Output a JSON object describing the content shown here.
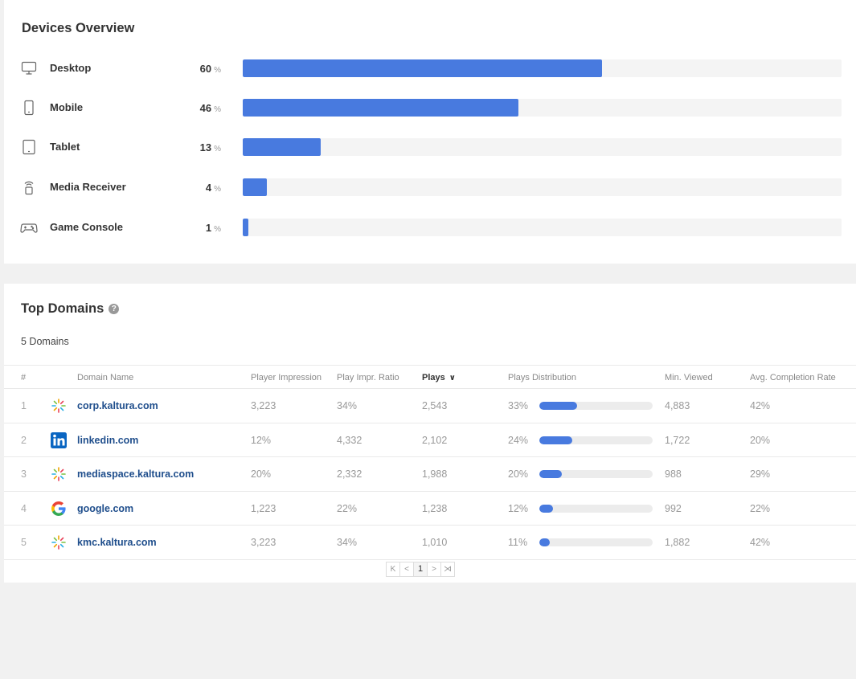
{
  "devices": {
    "title": "Devices Overview",
    "pct_unit": "%",
    "items": [
      {
        "icon": "desktop-icon",
        "label": "Desktop",
        "value": "60",
        "fraction": 0.6
      },
      {
        "icon": "mobile-icon",
        "label": "Mobile",
        "value": "46",
        "fraction": 0.46
      },
      {
        "icon": "tablet-icon",
        "label": "Tablet",
        "value": "13",
        "fraction": 0.13
      },
      {
        "icon": "media-receiver-icon",
        "label": "Media Receiver",
        "value": "4",
        "fraction": 0.04
      },
      {
        "icon": "game-console-icon",
        "label": "Game Console",
        "value": "1",
        "fraction": 0.01
      }
    ]
  },
  "domains": {
    "title": "Top Domains",
    "help_glyph": "?",
    "count_label": "5 Domains",
    "columns": {
      "rank": "#",
      "domain": "Domain Name",
      "impressions": "Player Impression",
      "ratio": "Play Impr. Ratio",
      "plays": "Plays",
      "distribution": "Plays Distribution",
      "min_viewed": "Min. Viewed",
      "completion": "Avg. Completion Rate"
    },
    "sort_glyph": "∨",
    "rows": [
      {
        "rank": "1",
        "logo": "kaltura-logo-icon",
        "domain": "corp.kaltura.com",
        "impressions": "3,223",
        "ratio": "34%",
        "plays": "2,543",
        "dist": "33%",
        "dist_fraction": 0.33,
        "min_viewed": "4,883",
        "completion": "42%"
      },
      {
        "rank": "2",
        "logo": "linkedin-logo-icon",
        "domain": "linkedin.com",
        "impressions": "12%",
        "ratio": "4,332",
        "plays": "2,102",
        "dist": "24%",
        "dist_fraction": 0.29,
        "min_viewed": "1,722",
        "completion": "20%"
      },
      {
        "rank": "3",
        "logo": "kaltura-logo-icon",
        "domain": "mediaspace.kaltura.com",
        "impressions": "20%",
        "ratio": "2,332",
        "plays": "1,988",
        "dist": "20%",
        "dist_fraction": 0.2,
        "min_viewed": "988",
        "completion": "29%"
      },
      {
        "rank": "4",
        "logo": "google-logo-icon",
        "domain": "google.com",
        "impressions": "1,223",
        "ratio": "22%",
        "plays": "1,238",
        "dist": "12%",
        "dist_fraction": 0.12,
        "min_viewed": "992",
        "completion": "22%"
      },
      {
        "rank": "5",
        "logo": "kaltura-logo-icon",
        "domain": "kmc.kaltura.com",
        "impressions": "3,223",
        "ratio": "34%",
        "plays": "1,010",
        "dist": "11%",
        "dist_fraction": 0.09,
        "min_viewed": "1,882",
        "completion": "42%"
      }
    ],
    "pager": {
      "first": "K",
      "prev": "<",
      "current": "1",
      "next": ">",
      "last": "⋊"
    }
  },
  "colors": {
    "accent": "#487adf",
    "link": "#1f4e8c",
    "track": "#f4f4f4"
  }
}
